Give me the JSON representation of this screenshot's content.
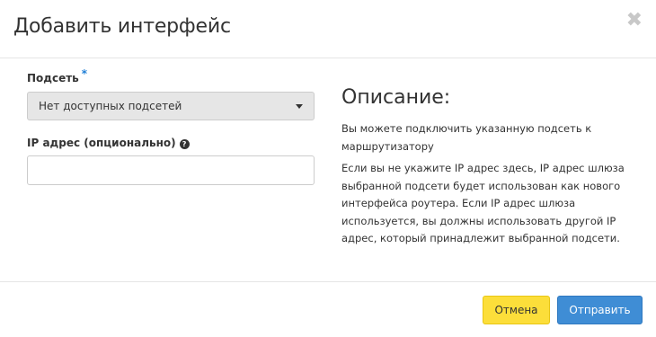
{
  "dialog": {
    "title": "Добавить интерфейс",
    "close_glyph": "✖"
  },
  "form": {
    "subnet_label": "Подсеть",
    "required_mark": "*",
    "subnet_selected": "Нет доступных подсетей",
    "ip_label": "IP адрес (опционально)",
    "help_glyph": "?",
    "ip_value": "",
    "ip_placeholder": ""
  },
  "description": {
    "title": "Описание:",
    "paragraph1": "Вы можете подключить указанную подсеть к маршрутизатору",
    "paragraph2": "Если вы не укажите IP адрес здесь, IP адрес шлюза выбранной подсети будет использован как нового интерфейса роутера. Если IP адрес шлюза используется, вы должны использовать другой IP адрес, который принадлежит выбранной подсети."
  },
  "footer": {
    "cancel_label": "Отмена",
    "submit_label": "Отправить"
  },
  "colors": {
    "cancel_button": "#fcde3a",
    "submit_button": "#3f8dd5",
    "required_star": "#1f7fd6",
    "select_bg": "#e6e6e6"
  },
  "icons": {
    "close": "close-icon",
    "help": "question-circle-icon",
    "dropdown": "caret-down-icon"
  }
}
